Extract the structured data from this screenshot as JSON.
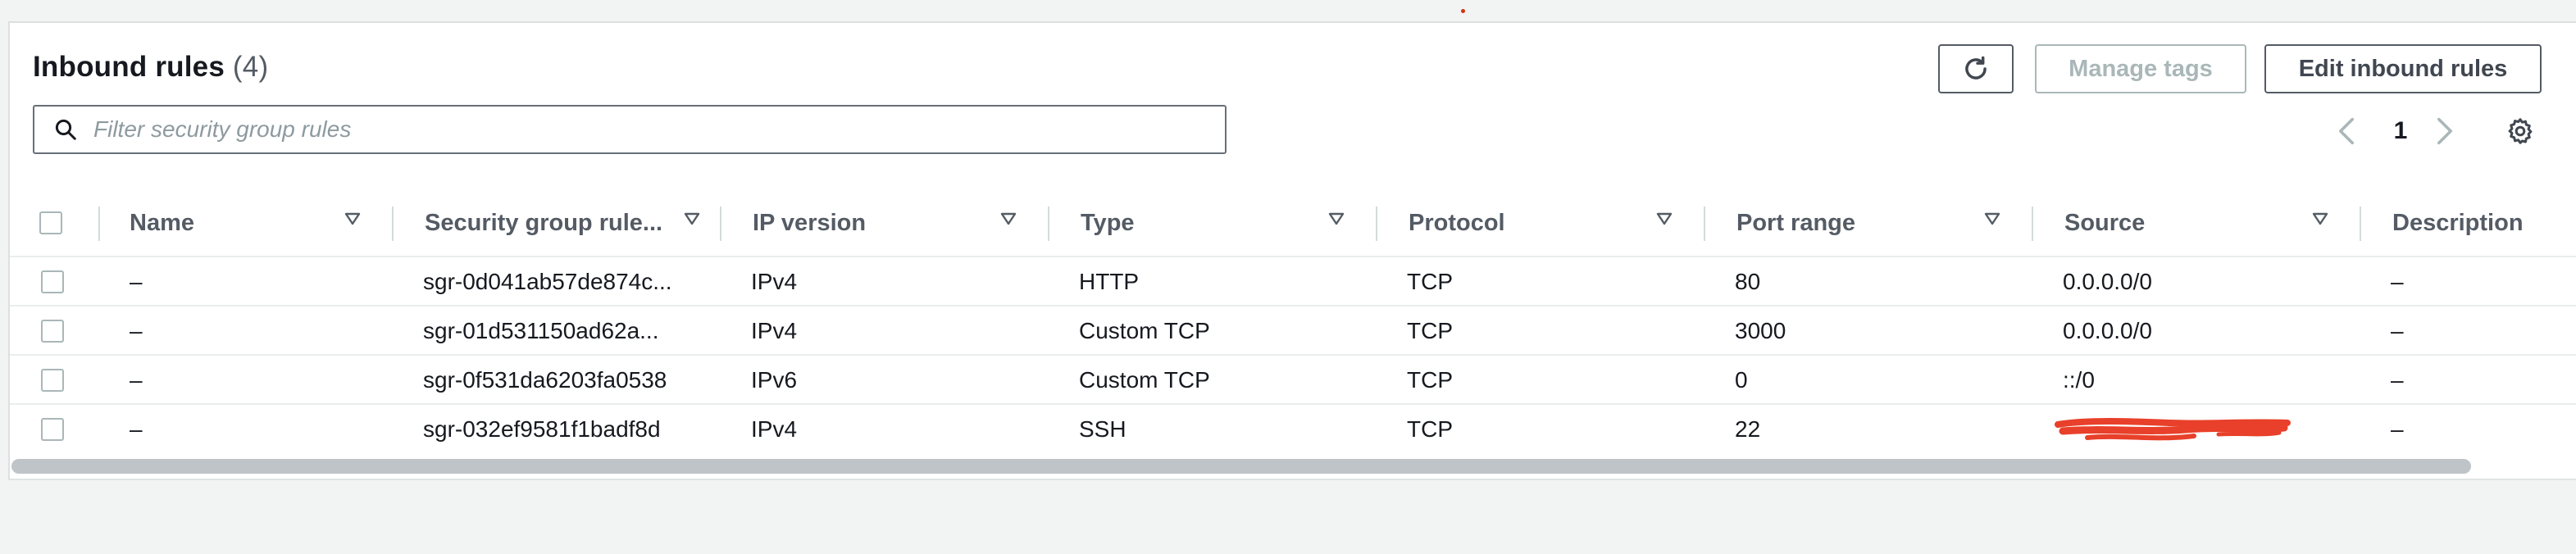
{
  "header": {
    "title": "Inbound rules",
    "count": "(4)"
  },
  "actions": {
    "refresh_icon": "refresh-icon",
    "manage_tags": "Manage tags",
    "edit_rules": "Edit inbound rules"
  },
  "search": {
    "placeholder": "Filter security group rules",
    "icon": "search-icon"
  },
  "pagination": {
    "current_page": "1",
    "prev_icon": "chevron-left-icon",
    "next_icon": "chevron-right-icon",
    "settings_icon": "gear-icon"
  },
  "table": {
    "columns": [
      "Name",
      "Security group rule...",
      "IP version",
      "Type",
      "Protocol",
      "Port range",
      "Source",
      "Description"
    ],
    "rows": [
      {
        "name": "–",
        "rule_id": "sgr-0d041ab57de874c...",
        "ip_version": "IPv4",
        "type": "HTTP",
        "protocol": "TCP",
        "port_range": "80",
        "source": "0.0.0.0/0",
        "description": "–"
      },
      {
        "name": "–",
        "rule_id": "sgr-01d531150ad62a...",
        "ip_version": "IPv4",
        "type": "Custom TCP",
        "protocol": "TCP",
        "port_range": "3000",
        "source": "0.0.0.0/0",
        "description": "–"
      },
      {
        "name": "–",
        "rule_id": "sgr-0f531da6203fa0538",
        "ip_version": "IPv6",
        "type": "Custom TCP",
        "protocol": "TCP",
        "port_range": "0",
        "source": "::/0",
        "description": "–"
      },
      {
        "name": "–",
        "rule_id": "sgr-032ef9581f1badf8d",
        "ip_version": "IPv4",
        "type": "SSH",
        "protocol": "TCP",
        "port_range": "22",
        "source": "",
        "description": "–"
      }
    ]
  },
  "colors": {
    "redaction": "#e8402a",
    "text_primary": "#16191f",
    "text_secondary": "#545b64",
    "disabled": "#aab7b8"
  }
}
